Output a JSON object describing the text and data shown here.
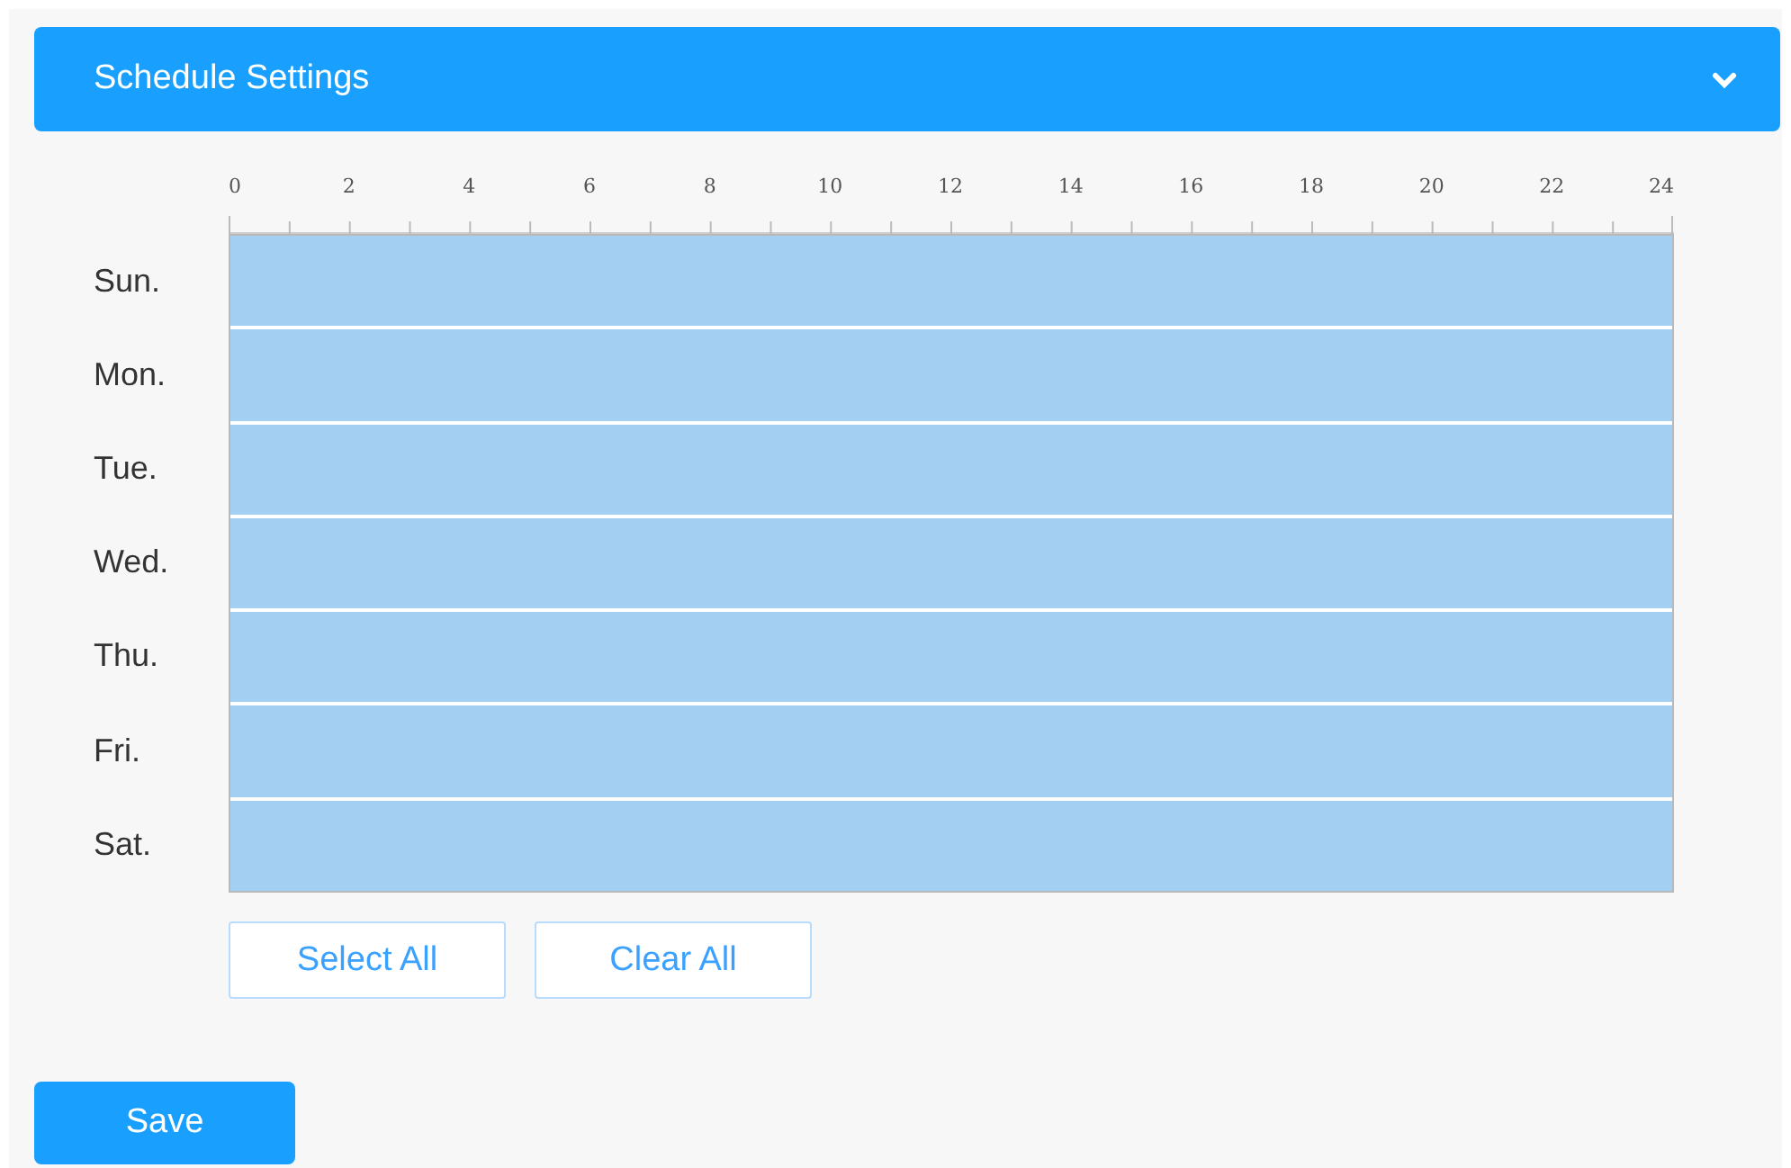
{
  "header": {
    "title": "Schedule Settings",
    "expanded": true
  },
  "ruler": {
    "labels": [
      "0",
      "2",
      "4",
      "6",
      "8",
      "10",
      "12",
      "14",
      "16",
      "18",
      "20",
      "22",
      "24"
    ]
  },
  "days": [
    {
      "label": "Sun.",
      "level": 1
    },
    {
      "label": "Mon.",
      "level": 1
    },
    {
      "label": "Tue.",
      "level": 1
    },
    {
      "label": "Wed.",
      "level": 1
    },
    {
      "label": "Thu.",
      "level": 1
    },
    {
      "label": "Fri.",
      "level": 1
    },
    {
      "label": "Sat.",
      "level": 1
    }
  ],
  "grid_buttons": [
    "Select All",
    "Clear All"
  ],
  "save_button": "Save"
}
